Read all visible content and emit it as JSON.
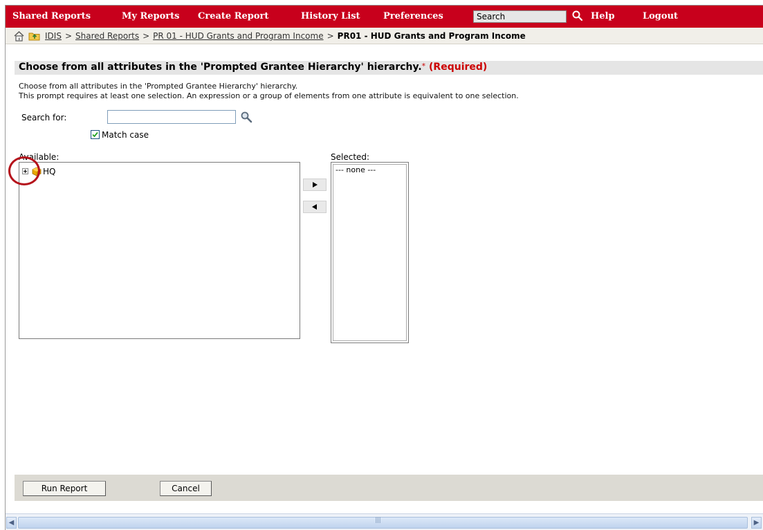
{
  "nav": {
    "items": [
      "Shared Reports",
      "My Reports",
      "Create Report",
      "History List",
      "Preferences"
    ],
    "search_placeholder": "Search",
    "help": "Help",
    "logout": "Logout"
  },
  "breadcrumb": {
    "links": [
      "IDIS",
      "Shared Reports",
      "PR 01 - HUD Grants and Program Income"
    ],
    "separator": ">",
    "current": "PR01 - HUD Grants and Program Income"
  },
  "prompt": {
    "title": "Choose from all attributes in the 'Prompted Grantee Hierarchy' hierarchy.",
    "required_star": "*",
    "required_label": "(Required)",
    "description_1": "Choose from all attributes in the 'Prompted Grantee Hierarchy' hierarchy.",
    "description_2": "This prompt requires at least one selection. An expression or a group of elements from one attribute is equivalent to one selection.",
    "search_label": "Search for:",
    "search_value": "",
    "match_case_label": "Match case",
    "match_case_checked": true,
    "available_label": "Available:",
    "selected_label": "Selected:",
    "available_items": [
      "HQ"
    ],
    "selected_empty": "--- none ---"
  },
  "footer": {
    "run_report": "Run Report",
    "cancel": "Cancel"
  },
  "colors": {
    "nav_bg": "#c8001c",
    "required": "#cc0000",
    "highlight_circle": "#b5121b"
  }
}
